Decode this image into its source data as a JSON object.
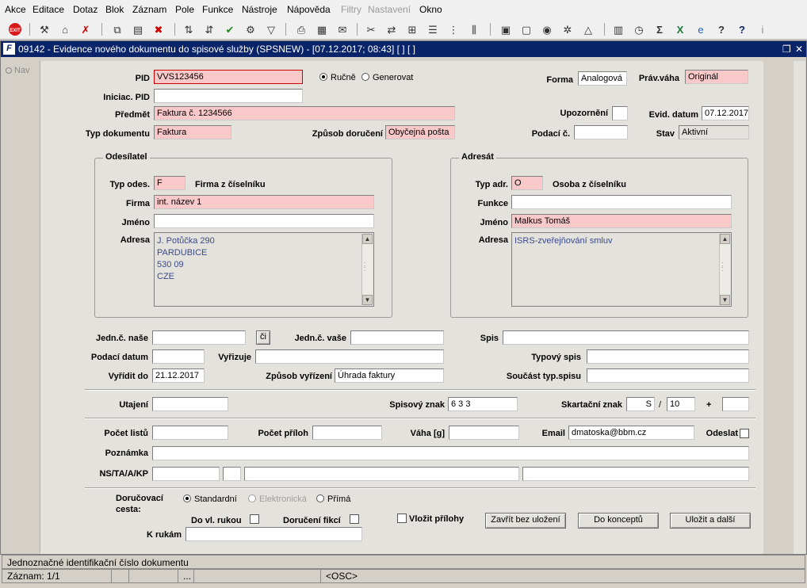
{
  "menu": [
    "Akce",
    "Editace",
    "Dotaz",
    "Blok",
    "Záznam",
    "Pole",
    "Funkce",
    "Nástroje",
    "Nápověda",
    "Filtry",
    "Nastavení",
    "Okno"
  ],
  "menu_disabled": [
    "Filtry",
    "Nastavení"
  ],
  "toolbar_icons": [
    "exit-icon",
    "hammer-icon",
    "house-icon",
    "cancel-icon",
    "copy-icon",
    "paste-icon",
    "delete-icon",
    "sort-asc-icon",
    "sort-desc-icon",
    "check-icon",
    "wrench-icon",
    "filter-icon",
    "print-icon",
    "preview-icon",
    "mail-icon",
    "scissors-icon",
    "transfer-icon",
    "tree-icon",
    "list-icon",
    "columns-icon",
    "clipboard-icon",
    "page-icon",
    "globe-icon",
    "gear-icon",
    "mountain-icon",
    "chart-icon",
    "clock-icon",
    "sigma-icon",
    "excel-icon",
    "edge-icon",
    "help-icon",
    "question-icon",
    "info-icon"
  ],
  "window": {
    "title": "09142 - Evidence nového dokumentu do spisové služby (SPSNEW) - [07.12.2017; 08:43]  [ ] [ ]",
    "logo": "F"
  },
  "nav": "Nav",
  "form": {
    "pid_label": "PID",
    "pid": "VVS123456",
    "rucne": "Ručně",
    "generovat": "Generovat",
    "forma_label": "Forma",
    "forma": "Analogová",
    "pravaha_label": "Práv.váha",
    "pravaha": "Originál",
    "iniciac_label": "Iniciac. PID",
    "iniciac": "",
    "predmet_label": "Předmět",
    "predmet": "Faktura č. 1234566",
    "upozorneni_label": "Upozornění",
    "upozorneni": "",
    "evid_label": "Evid. datum",
    "evid": "07.12.2017",
    "typdok_label": "Typ dokumentu",
    "typdok": "Faktura",
    "zpusob_label": "Způsob doručení",
    "zpusob": "Obyčejná pošta",
    "podaci_label": "Podací č.",
    "podaci": "",
    "stav_label": "Stav",
    "stav": "Aktivní"
  },
  "odesilatel": {
    "title": "Odesílatel",
    "typ_label": "Typ odes.",
    "typ": "F",
    "typ_desc": "Firma z číselníku",
    "firma_label": "Firma",
    "firma": "int. název 1",
    "jmeno_label": "Jméno",
    "jmeno": "",
    "adresa_label": "Adresa",
    "adresa": [
      "J. Potůčka 290",
      "PARDUBICE",
      "530 09",
      "CZE"
    ]
  },
  "adresat": {
    "title": "Adresát",
    "typ_label": "Typ adr.",
    "typ": "O",
    "typ_desc": "Osoba z číselníku",
    "funkce_label": "Funkce",
    "funkce": "",
    "jmeno_label": "Jméno",
    "jmeno": "Malkus Tomáš",
    "adresa_label": "Adresa",
    "adresa": [
      "ISRS-zveřejňování smluv"
    ]
  },
  "middle": {
    "jednc_nase_label": "Jedn.č. naše",
    "jednc_nase": "",
    "ci_button": "či",
    "jednc_vase_label": "Jedn.č. vaše",
    "jednc_vase": "",
    "spis_label": "Spis",
    "spis": "",
    "podaci_datum_label": "Podací datum",
    "podaci_datum": "",
    "vyrizuje_label": "Vyřizuje",
    "vyrizuje": "",
    "typovy_spis_label": "Typový spis",
    "typovy_spis": "",
    "vyridit_label": "Vyřídit do",
    "vyridit": "21.12.2017",
    "zpusob_vyrizeni_label": "Způsob vyřízení",
    "zpusob_vyrizeni": "Úhrada faktury",
    "soucast_label": "Součást typ.spisu",
    "soucast": ""
  },
  "znaky": {
    "utajeni_label": "Utajení",
    "utajeni": "",
    "spisovy_label": "Spisový znak",
    "spisovy": "6 3 3",
    "skartacni_label": "Skartační znak",
    "skartacni": "S",
    "slash": "/",
    "lhuta": "10",
    "plus": "+",
    "extra": ""
  },
  "detail": {
    "pocet_listu_label": "Počet listů",
    "pocet_listu": "",
    "pocet_priloh_label": "Počet příloh",
    "pocet_priloh": "",
    "vaha_label": "Váha [g]",
    "vaha": "",
    "email_label": "Email",
    "email": "dmatoska@bbm.cz",
    "odeslat_label": "Odeslat",
    "poznamka_label": "Poznámka",
    "poznamka": "",
    "ns_label": "NS/TA/A/KP"
  },
  "footer": {
    "dorucovaci_label": "Doručovací cesta:",
    "standardni": "Standardní",
    "elektronicka": "Elektronická",
    "prima": "Přímá",
    "do_vl_label": "Do vl. rukou",
    "doruceni_fikci_label": "Doručení fikcí",
    "vlozit_label": "Vložit přílohy",
    "k_rukam_label": "K rukám",
    "k_rukam": "",
    "btn_zavrit": "Zavřít bez uložení",
    "btn_koncept": "Do konceptů",
    "btn_ulozit": "Uložit a další"
  },
  "status": {
    "hint": "Jednoznačné identifikační číslo dokumentu",
    "record": "Záznam: 1/1",
    "dots": "...",
    "osc": "<OSC>"
  }
}
